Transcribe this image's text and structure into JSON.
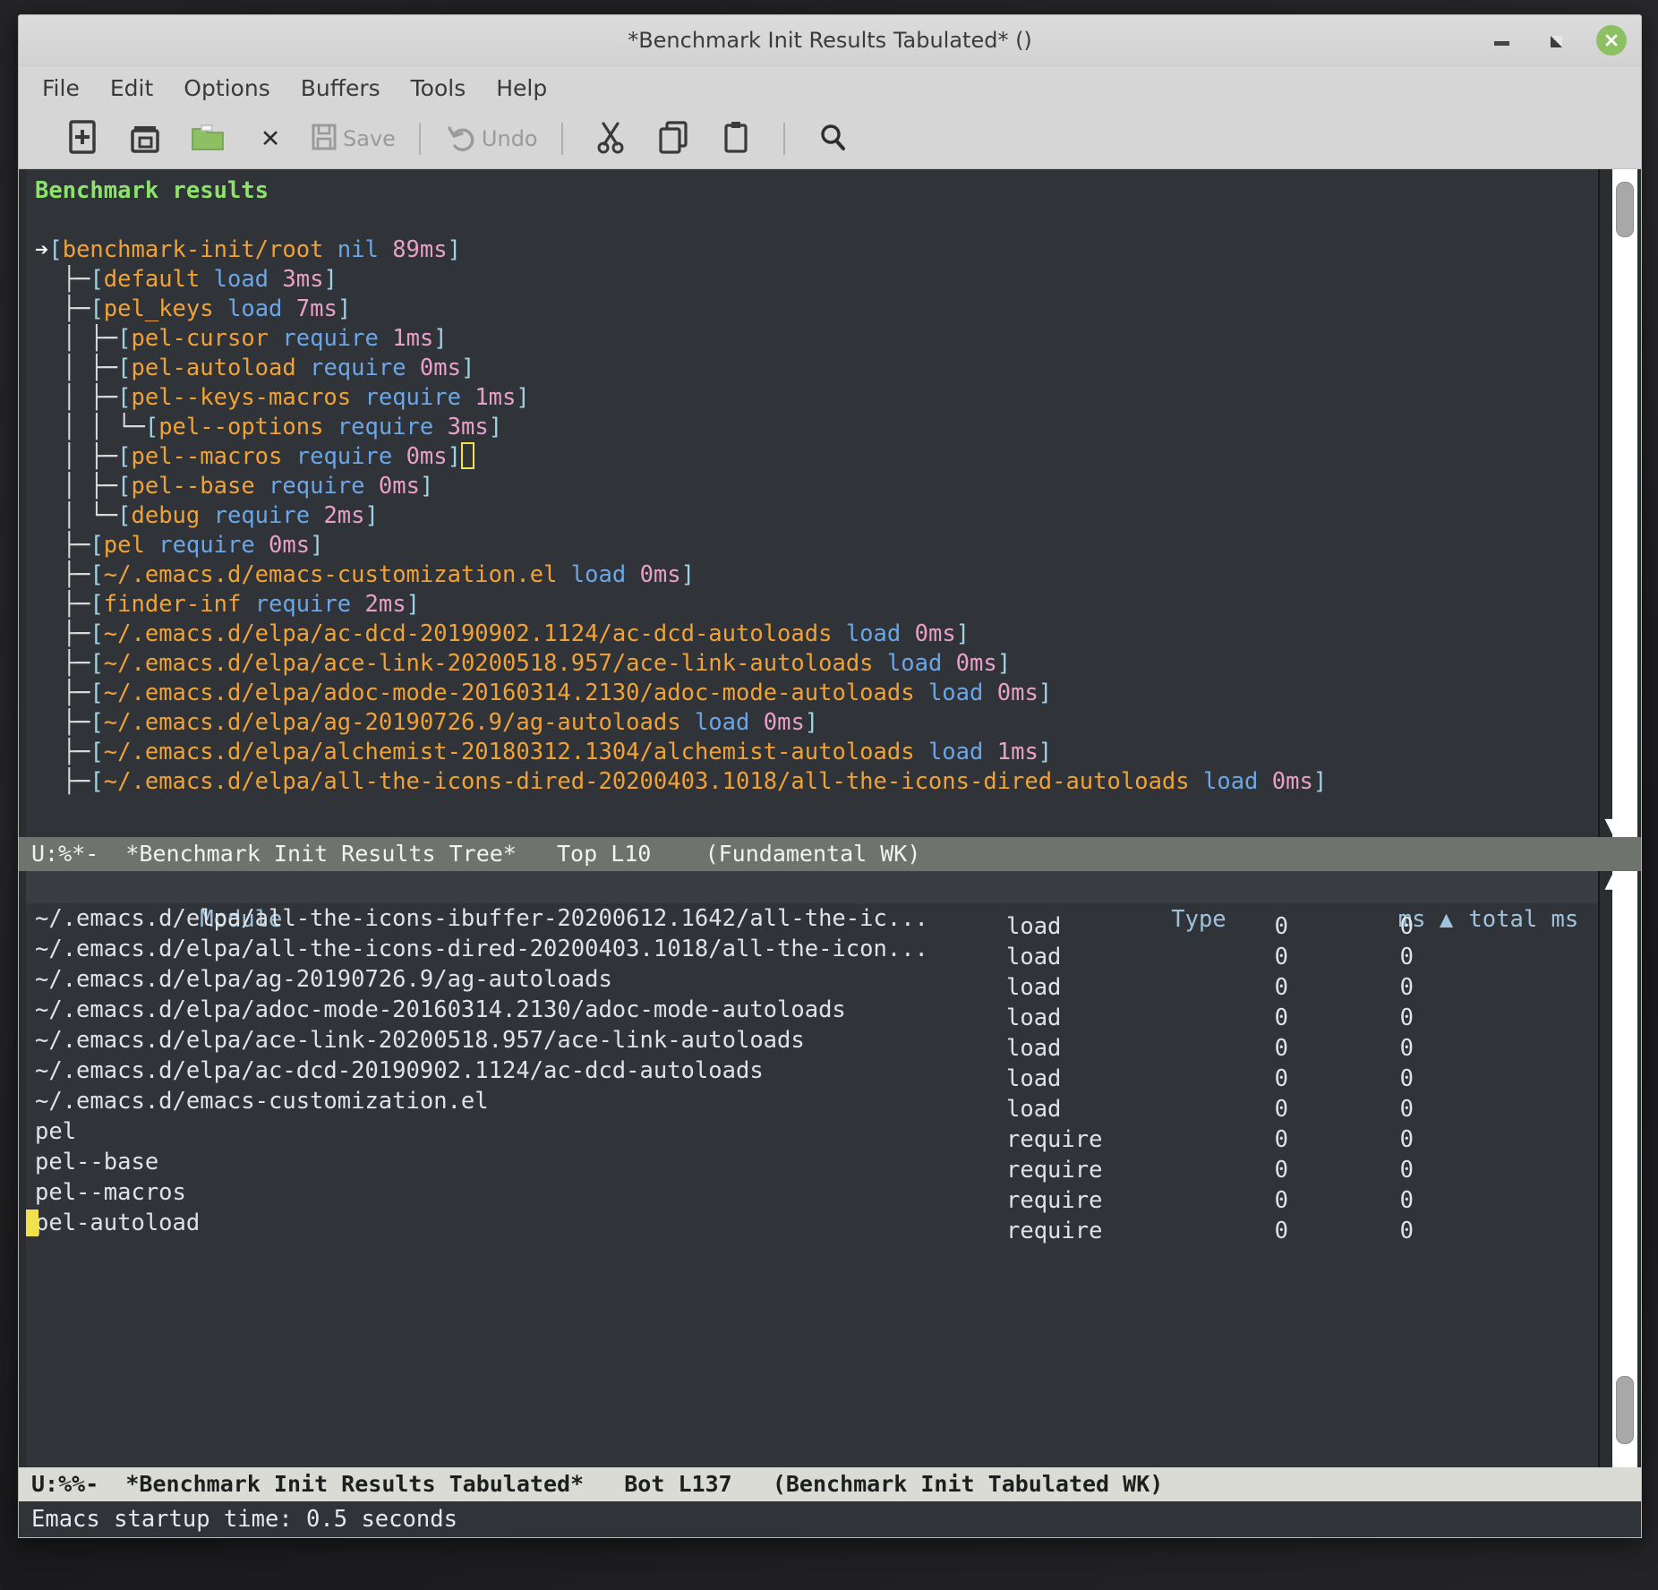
{
  "window": {
    "title": "*Benchmark Init Results Tabulated* ()",
    "controls": {
      "minimize": "minimize-button",
      "maximize": "maximize-button",
      "close": "close-button"
    }
  },
  "menubar": {
    "items": [
      "File",
      "Edit",
      "Options",
      "Buffers",
      "Tools",
      "Help"
    ]
  },
  "toolbar": {
    "items": [
      {
        "name": "new-file-icon",
        "label": ""
      },
      {
        "name": "open-file-icon",
        "label": ""
      },
      {
        "name": "open-directory-icon",
        "label": ""
      },
      {
        "name": "close-buffer-icon",
        "label": "✕"
      },
      {
        "name": "save-icon",
        "label": "Save"
      },
      {
        "name": "undo-icon",
        "label": "Undo"
      },
      {
        "name": "cut-icon",
        "label": ""
      },
      {
        "name": "copy-icon",
        "label": ""
      },
      {
        "name": "paste-icon",
        "label": ""
      },
      {
        "name": "search-icon",
        "label": ""
      }
    ],
    "save_label": "Save",
    "undo_label": "Undo",
    "close_label": "✕"
  },
  "tree_buffer": {
    "heading": "Benchmark results",
    "root_arrow": "➡",
    "lines": [
      {
        "guide": "",
        "open": "[",
        "module": "benchmark-init/root",
        "type": "nil",
        "ms": "89ms",
        "close": "]",
        "arrow": true
      },
      {
        "guide": "├─",
        "open": "[",
        "module": "default",
        "type": "load",
        "ms": "3ms",
        "close": "]"
      },
      {
        "guide": "├─",
        "open": "[",
        "module": "pel_keys",
        "type": "load",
        "ms": "7ms",
        "close": "]"
      },
      {
        "guide": "│ ├─",
        "open": "[",
        "module": "pel-cursor",
        "type": "require",
        "ms": "1ms",
        "close": "]"
      },
      {
        "guide": "│ ├─",
        "open": "[",
        "module": "pel-autoload",
        "type": "require",
        "ms": "0ms",
        "close": "]"
      },
      {
        "guide": "│ ├─",
        "open": "[",
        "module": "pel--keys-macros",
        "type": "require",
        "ms": "1ms",
        "close": "]"
      },
      {
        "guide": "│ │ └─",
        "open": "[",
        "module": "pel--options",
        "type": "require",
        "ms": "3ms",
        "close": "]"
      },
      {
        "guide": "│ ├─",
        "open": "[",
        "module": "pel--macros",
        "type": "require",
        "ms": "0ms",
        "close": "]",
        "cursor": true
      },
      {
        "guide": "│ ├─",
        "open": "[",
        "module": "pel--base",
        "type": "require",
        "ms": "0ms",
        "close": "]"
      },
      {
        "guide": "│ └─",
        "open": "[",
        "module": "debug",
        "type": "require",
        "ms": "2ms",
        "close": "]"
      },
      {
        "guide": "├─",
        "open": "[",
        "module": "pel",
        "type": "require",
        "ms": "0ms",
        "close": "]"
      },
      {
        "guide": "├─",
        "open": "[",
        "module": "~/.emacs.d/emacs-customization.el",
        "type": "load",
        "ms": "0ms",
        "close": "]"
      },
      {
        "guide": "├─",
        "open": "[",
        "module": "finder-inf",
        "type": "require",
        "ms": "2ms",
        "close": "]"
      },
      {
        "guide": "├─",
        "open": "[",
        "module": "~/.emacs.d/elpa/ac-dcd-20190902.1124/ac-dcd-autoloads",
        "type": "load",
        "ms": "0ms",
        "close": "]"
      },
      {
        "guide": "├─",
        "open": "[",
        "module": "~/.emacs.d/elpa/ace-link-20200518.957/ace-link-autoloads",
        "type": "load",
        "ms": "0ms",
        "close": "]"
      },
      {
        "guide": "├─",
        "open": "[",
        "module": "~/.emacs.d/elpa/adoc-mode-20160314.2130/adoc-mode-autoloads",
        "type": "load",
        "ms": "0ms",
        "close": "]"
      },
      {
        "guide": "├─",
        "open": "[",
        "module": "~/.emacs.d/elpa/ag-20190726.9/ag-autoloads",
        "type": "load",
        "ms": "0ms",
        "close": "]"
      },
      {
        "guide": "├─",
        "open": "[",
        "module": "~/.emacs.d/elpa/alchemist-20180312.1304/alchemist-autoloads",
        "type": "load",
        "ms": "1ms",
        "close": "]"
      },
      {
        "guide": "├─",
        "open": "[",
        "module": "~/.emacs.d/elpa/all-the-icons-dired-20200403.1018/all-the-icons-dired-autoloads",
        "type": "load",
        "ms": "0ms",
        "close": "]"
      }
    ]
  },
  "tree_modeline": "U:%*-  *Benchmark Init Results Tree*   Top L10    (Fundamental WK)",
  "table": {
    "columns": [
      "Module",
      "Type",
      "ms ▲",
      "total ms"
    ],
    "column_headers": {
      "module": "Module",
      "type": "Type",
      "ms": "ms",
      "sort_indicator": "▲",
      "total_ms": "total ms"
    },
    "rows": [
      {
        "module": "~/.emacs.d/elpa/all-the-icons-ibuffer-20200612.1642/all-the-ic...",
        "type": "load",
        "ms": "0",
        "total_ms": "0"
      },
      {
        "module": "~/.emacs.d/elpa/all-the-icons-dired-20200403.1018/all-the-icon...",
        "type": "load",
        "ms": "0",
        "total_ms": "0"
      },
      {
        "module": "~/.emacs.d/elpa/ag-20190726.9/ag-autoloads",
        "type": "load",
        "ms": "0",
        "total_ms": "0"
      },
      {
        "module": "~/.emacs.d/elpa/adoc-mode-20160314.2130/adoc-mode-autoloads",
        "type": "load",
        "ms": "0",
        "total_ms": "0"
      },
      {
        "module": "~/.emacs.d/elpa/ace-link-20200518.957/ace-link-autoloads",
        "type": "load",
        "ms": "0",
        "total_ms": "0"
      },
      {
        "module": "~/.emacs.d/elpa/ac-dcd-20190902.1124/ac-dcd-autoloads",
        "type": "load",
        "ms": "0",
        "total_ms": "0"
      },
      {
        "module": "~/.emacs.d/emacs-customization.el",
        "type": "load",
        "ms": "0",
        "total_ms": "0"
      },
      {
        "module": "pel",
        "type": "require",
        "ms": "0",
        "total_ms": "0"
      },
      {
        "module": "pel--base",
        "type": "require",
        "ms": "0",
        "total_ms": "0"
      },
      {
        "module": "pel--macros",
        "type": "require",
        "ms": "0",
        "total_ms": "0"
      },
      {
        "module": "pel-autoload",
        "type": "require",
        "ms": "0",
        "total_ms": "0",
        "cursor": true
      }
    ]
  },
  "table_modeline": "U:%%-  *Benchmark Init Results Tabulated*   Bot L137   (Benchmark Init Tabulated WK)",
  "echo_area": "Emacs startup time: 0.5 seconds",
  "colors": {
    "background": "#303438",
    "heading_green": "#8ce26a",
    "module_orange": "#f0a237",
    "keyword_blue": "#6aa6e8",
    "ms_pink": "#e8a0c8",
    "bracket_cyan": "#9fd2e6",
    "cursor_yellow": "#f2e14c",
    "modeline_active": "#d9dbd4",
    "modeline_inactive": "#6f736d",
    "close_button_green": "#8cc063"
  }
}
